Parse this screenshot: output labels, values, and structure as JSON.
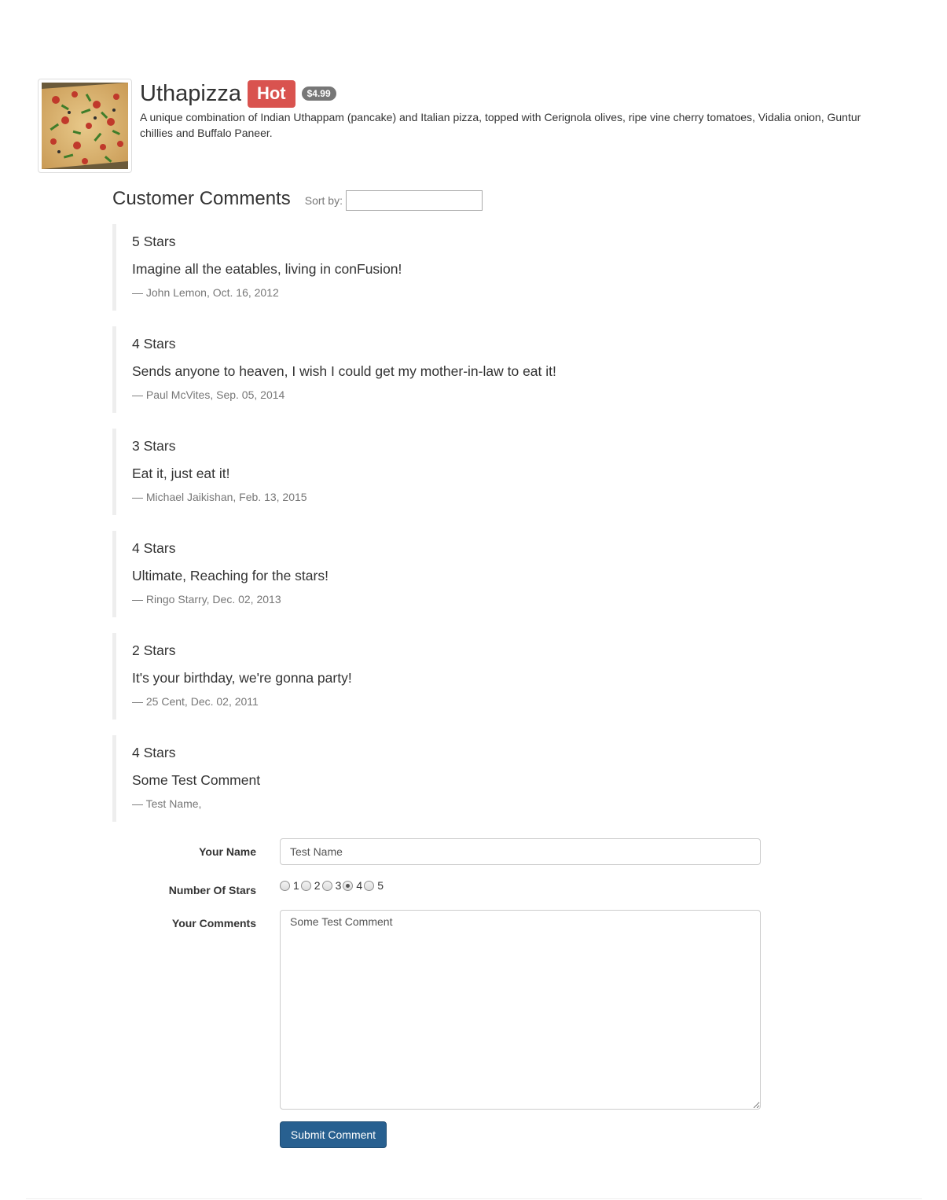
{
  "dish": {
    "name": "Uthapizza",
    "label": "Hot",
    "price": "$4.99",
    "description": "A unique combination of Indian Uthappam (pancake) and Italian pizza, topped with Cerignola olives, ripe vine cherry tomatoes, Vidalia onion, Guntur chillies and Buffalo Paneer.",
    "image_alt": "Uthapizza"
  },
  "comments_section": {
    "title": "Customer Comments",
    "sort_label": "Sort by:",
    "sort_value": ""
  },
  "comments": [
    {
      "stars": "5 Stars",
      "text": "Imagine all the eatables, living in conFusion!",
      "footer": "— John Lemon, Oct. 16, 2012"
    },
    {
      "stars": "4 Stars",
      "text": "Sends anyone to heaven, I wish I could get my mother-in-law to eat it!",
      "footer": "— Paul McVites, Sep. 05, 2014"
    },
    {
      "stars": "3 Stars",
      "text": "Eat it, just eat it!",
      "footer": "— Michael Jaikishan, Feb. 13, 2015"
    },
    {
      "stars": "4 Stars",
      "text": "Ultimate, Reaching for the stars!",
      "footer": "— Ringo Starry, Dec. 02, 2013"
    },
    {
      "stars": "2 Stars",
      "text": "It's your birthday, we're gonna party!",
      "footer": "— 25 Cent, Dec. 02, 2011"
    },
    {
      "stars": "4 Stars",
      "text": "Some Test Comment",
      "footer": "— Test Name,"
    }
  ],
  "form": {
    "name_label": "Your Name",
    "name_value": "Test Name",
    "stars_label": "Number Of Stars",
    "star_options": [
      "1",
      "2",
      "3",
      "4",
      "5"
    ],
    "selected_stars": "4",
    "comments_label": "Your Comments",
    "comments_value": "Some Test Comment",
    "submit_label": "Submit Comment"
  }
}
